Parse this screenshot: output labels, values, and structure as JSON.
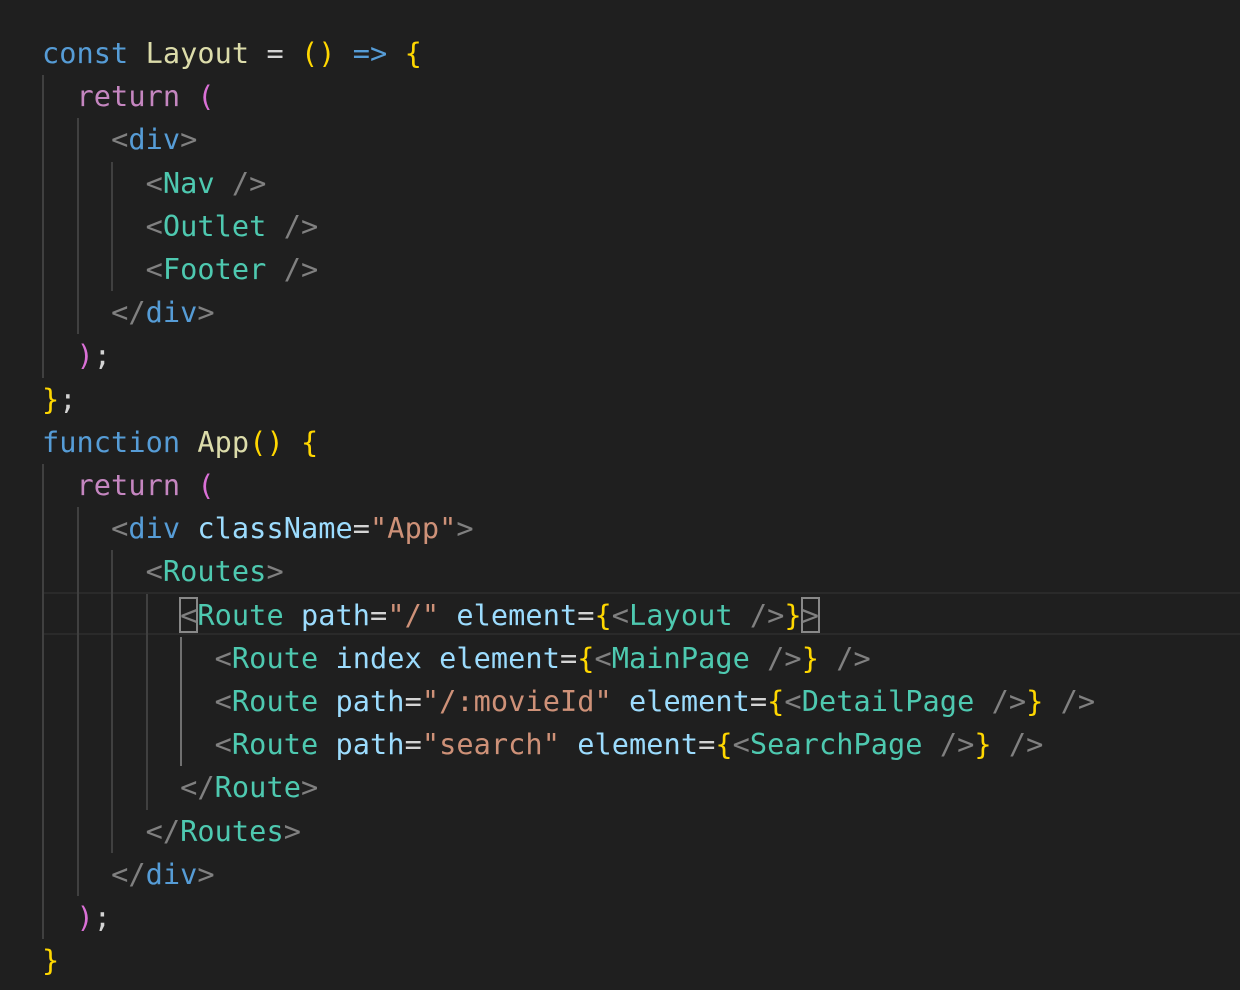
{
  "theme": {
    "background": "#1f1f1f",
    "keyword": "#569cd6",
    "control": "#c586c0",
    "function": "#dcdcaa",
    "jsx_tag": "#4ec9b0",
    "html_tag": "#569cd6",
    "attribute": "#9cdcfe",
    "string": "#ce9178",
    "bracket_yellow": "#ffd700",
    "bracket_purple": "#da70d6",
    "punctuation": "#808080",
    "default": "#d4d4d4"
  },
  "lines": [
    [
      {
        "t": "const",
        "c": "keyword"
      },
      {
        "t": " ",
        "c": "default"
      },
      {
        "t": "Layout",
        "c": "function"
      },
      {
        "t": " = ",
        "c": "default"
      },
      {
        "t": "()",
        "c": "bracket_yellow"
      },
      {
        "t": " ",
        "c": "default"
      },
      {
        "t": "=>",
        "c": "keyword"
      },
      {
        "t": " ",
        "c": "default"
      },
      {
        "t": "{",
        "c": "bracket_yellow"
      }
    ],
    [
      {
        "t": "  ",
        "c": "default"
      },
      {
        "t": "return",
        "c": "control"
      },
      {
        "t": " ",
        "c": "default"
      },
      {
        "t": "(",
        "c": "bracket_purple"
      }
    ],
    [
      {
        "t": "    ",
        "c": "default"
      },
      {
        "t": "<",
        "c": "punctuation"
      },
      {
        "t": "div",
        "c": "html_tag"
      },
      {
        "t": ">",
        "c": "punctuation"
      }
    ],
    [
      {
        "t": "      ",
        "c": "default"
      },
      {
        "t": "<",
        "c": "punctuation"
      },
      {
        "t": "Nav",
        "c": "jsx_tag"
      },
      {
        "t": " ",
        "c": "default"
      },
      {
        "t": "/>",
        "c": "punctuation"
      }
    ],
    [
      {
        "t": "      ",
        "c": "default"
      },
      {
        "t": "<",
        "c": "punctuation"
      },
      {
        "t": "Outlet",
        "c": "jsx_tag"
      },
      {
        "t": " ",
        "c": "default"
      },
      {
        "t": "/>",
        "c": "punctuation"
      }
    ],
    [
      {
        "t": "      ",
        "c": "default"
      },
      {
        "t": "<",
        "c": "punctuation"
      },
      {
        "t": "Footer",
        "c": "jsx_tag"
      },
      {
        "t": " ",
        "c": "default"
      },
      {
        "t": "/>",
        "c": "punctuation"
      }
    ],
    [
      {
        "t": "    ",
        "c": "default"
      },
      {
        "t": "</",
        "c": "punctuation"
      },
      {
        "t": "div",
        "c": "html_tag"
      },
      {
        "t": ">",
        "c": "punctuation"
      }
    ],
    [
      {
        "t": "  ",
        "c": "default"
      },
      {
        "t": ")",
        "c": "bracket_purple"
      },
      {
        "t": ";",
        "c": "default"
      }
    ],
    [
      {
        "t": "}",
        "c": "bracket_yellow"
      },
      {
        "t": ";",
        "c": "default"
      }
    ],
    [
      {
        "t": "function",
        "c": "keyword"
      },
      {
        "t": " ",
        "c": "default"
      },
      {
        "t": "App",
        "c": "function"
      },
      {
        "t": "()",
        "c": "bracket_yellow"
      },
      {
        "t": " ",
        "c": "default"
      },
      {
        "t": "{",
        "c": "bracket_yellow"
      }
    ],
    [
      {
        "t": "  ",
        "c": "default"
      },
      {
        "t": "return",
        "c": "control"
      },
      {
        "t": " ",
        "c": "default"
      },
      {
        "t": "(",
        "c": "bracket_purple"
      }
    ],
    [
      {
        "t": "    ",
        "c": "default"
      },
      {
        "t": "<",
        "c": "punctuation"
      },
      {
        "t": "div",
        "c": "html_tag"
      },
      {
        "t": " ",
        "c": "default"
      },
      {
        "t": "className",
        "c": "attribute"
      },
      {
        "t": "=",
        "c": "default"
      },
      {
        "t": "\"App\"",
        "c": "string"
      },
      {
        "t": ">",
        "c": "punctuation"
      }
    ],
    [
      {
        "t": "      ",
        "c": "default"
      },
      {
        "t": "<",
        "c": "punctuation"
      },
      {
        "t": "Routes",
        "c": "jsx_tag"
      },
      {
        "t": ">",
        "c": "punctuation"
      }
    ],
    [
      {
        "t": "        ",
        "c": "default"
      },
      {
        "t": "<",
        "c": "punctuation",
        "m": true
      },
      {
        "t": "Route",
        "c": "jsx_tag"
      },
      {
        "t": " ",
        "c": "default"
      },
      {
        "t": "path",
        "c": "attribute"
      },
      {
        "t": "=",
        "c": "default"
      },
      {
        "t": "\"/\"",
        "c": "string"
      },
      {
        "t": " ",
        "c": "default"
      },
      {
        "t": "element",
        "c": "attribute"
      },
      {
        "t": "=",
        "c": "default"
      },
      {
        "t": "{",
        "c": "bracket_yellow"
      },
      {
        "t": "<",
        "c": "punctuation"
      },
      {
        "t": "Layout",
        "c": "jsx_tag"
      },
      {
        "t": " ",
        "c": "default"
      },
      {
        "t": "/>",
        "c": "punctuation"
      },
      {
        "t": "}",
        "c": "bracket_yellow"
      },
      {
        "t": ">",
        "c": "punctuation",
        "m": true
      }
    ],
    [
      {
        "t": "          ",
        "c": "default"
      },
      {
        "t": "<",
        "c": "punctuation"
      },
      {
        "t": "Route",
        "c": "jsx_tag"
      },
      {
        "t": " ",
        "c": "default"
      },
      {
        "t": "index",
        "c": "attribute"
      },
      {
        "t": " ",
        "c": "default"
      },
      {
        "t": "element",
        "c": "attribute"
      },
      {
        "t": "=",
        "c": "default"
      },
      {
        "t": "{",
        "c": "bracket_yellow"
      },
      {
        "t": "<",
        "c": "punctuation"
      },
      {
        "t": "MainPage",
        "c": "jsx_tag"
      },
      {
        "t": " ",
        "c": "default"
      },
      {
        "t": "/>",
        "c": "punctuation"
      },
      {
        "t": "}",
        "c": "bracket_yellow"
      },
      {
        "t": " ",
        "c": "default"
      },
      {
        "t": "/>",
        "c": "punctuation"
      }
    ],
    [
      {
        "t": "          ",
        "c": "default"
      },
      {
        "t": "<",
        "c": "punctuation"
      },
      {
        "t": "Route",
        "c": "jsx_tag"
      },
      {
        "t": " ",
        "c": "default"
      },
      {
        "t": "path",
        "c": "attribute"
      },
      {
        "t": "=",
        "c": "default"
      },
      {
        "t": "\"/:movieId\"",
        "c": "string"
      },
      {
        "t": " ",
        "c": "default"
      },
      {
        "t": "element",
        "c": "attribute"
      },
      {
        "t": "=",
        "c": "default"
      },
      {
        "t": "{",
        "c": "bracket_yellow"
      },
      {
        "t": "<",
        "c": "punctuation"
      },
      {
        "t": "DetailPage",
        "c": "jsx_tag"
      },
      {
        "t": " ",
        "c": "default"
      },
      {
        "t": "/>",
        "c": "punctuation"
      },
      {
        "t": "}",
        "c": "bracket_yellow"
      },
      {
        "t": " ",
        "c": "default"
      },
      {
        "t": "/>",
        "c": "punctuation"
      }
    ],
    [
      {
        "t": "          ",
        "c": "default"
      },
      {
        "t": "<",
        "c": "punctuation"
      },
      {
        "t": "Route",
        "c": "jsx_tag"
      },
      {
        "t": " ",
        "c": "default"
      },
      {
        "t": "path",
        "c": "attribute"
      },
      {
        "t": "=",
        "c": "default"
      },
      {
        "t": "\"search\"",
        "c": "string"
      },
      {
        "t": " ",
        "c": "default"
      },
      {
        "t": "element",
        "c": "attribute"
      },
      {
        "t": "=",
        "c": "default"
      },
      {
        "t": "{",
        "c": "bracket_yellow"
      },
      {
        "t": "<",
        "c": "punctuation"
      },
      {
        "t": "SearchPage",
        "c": "jsx_tag"
      },
      {
        "t": " ",
        "c": "default"
      },
      {
        "t": "/>",
        "c": "punctuation"
      },
      {
        "t": "}",
        "c": "bracket_yellow"
      },
      {
        "t": " ",
        "c": "default"
      },
      {
        "t": "/>",
        "c": "punctuation"
      }
    ],
    [
      {
        "t": "        ",
        "c": "default"
      },
      {
        "t": "</",
        "c": "punctuation"
      },
      {
        "t": "Route",
        "c": "jsx_tag"
      },
      {
        "t": ">",
        "c": "punctuation"
      }
    ],
    [
      {
        "t": "      ",
        "c": "default"
      },
      {
        "t": "</",
        "c": "punctuation"
      },
      {
        "t": "Routes",
        "c": "jsx_tag"
      },
      {
        "t": ">",
        "c": "punctuation"
      }
    ],
    [
      {
        "t": "    ",
        "c": "default"
      },
      {
        "t": "</",
        "c": "punctuation"
      },
      {
        "t": "div",
        "c": "html_tag"
      },
      {
        "t": ">",
        "c": "punctuation"
      }
    ],
    [
      {
        "t": "  ",
        "c": "default"
      },
      {
        "t": ")",
        "c": "bracket_purple"
      },
      {
        "t": ";",
        "c": "default"
      }
    ],
    [
      {
        "t": "}",
        "c": "bracket_yellow"
      }
    ]
  ]
}
